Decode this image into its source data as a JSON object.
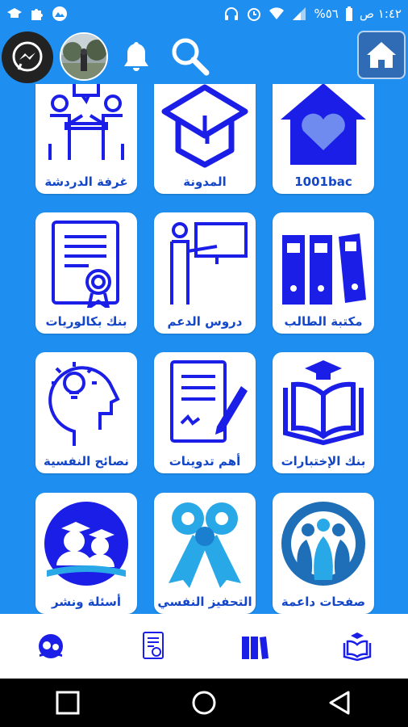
{
  "status_bar": {
    "time": "١:٤٢ ص",
    "battery": "%٥٦"
  },
  "header": {
    "messenger_icon": "messenger-icon",
    "avatar": "user-avatar",
    "bell_icon": "bell-icon",
    "search_icon": "search-icon",
    "home_icon": "home-icon"
  },
  "tiles": [
    {
      "label": "غرفة الدردشة",
      "icon": "chat-room-icon"
    },
    {
      "label": "المدونة",
      "icon": "graduation-cap-icon"
    },
    {
      "label": "1001bac",
      "icon": "home-heart-icon"
    },
    {
      "label": "بنك بكالوريات",
      "icon": "certificate-icon"
    },
    {
      "label": "دروس الدعم",
      "icon": "teacher-board-icon"
    },
    {
      "label": "مكتبة الطالب",
      "icon": "binders-icon"
    },
    {
      "label": "نصائح النفسية",
      "icon": "head-idea-icon"
    },
    {
      "label": "أهم تدوينات",
      "icon": "document-pen-icon"
    },
    {
      "label": "بنك الإختبارات",
      "icon": "book-cap-icon"
    },
    {
      "label": "أسئلة ونشر",
      "icon": "graduates-icon"
    },
    {
      "label": "التحفيز النفسي",
      "icon": "ribbon-icon"
    },
    {
      "label": "صفحات داعمة",
      "icon": "support-people-icon"
    }
  ],
  "bottom_nav": [
    {
      "icon": "graduates-nav-icon"
    },
    {
      "icon": "certificate-nav-icon"
    },
    {
      "icon": "binders-nav-icon"
    },
    {
      "icon": "book-cap-nav-icon"
    }
  ],
  "colors": {
    "background": "#1e8ff0",
    "icon_blue": "#1b1ee6",
    "label_blue": "#1446c8",
    "light_blue": "#29a8e8"
  }
}
